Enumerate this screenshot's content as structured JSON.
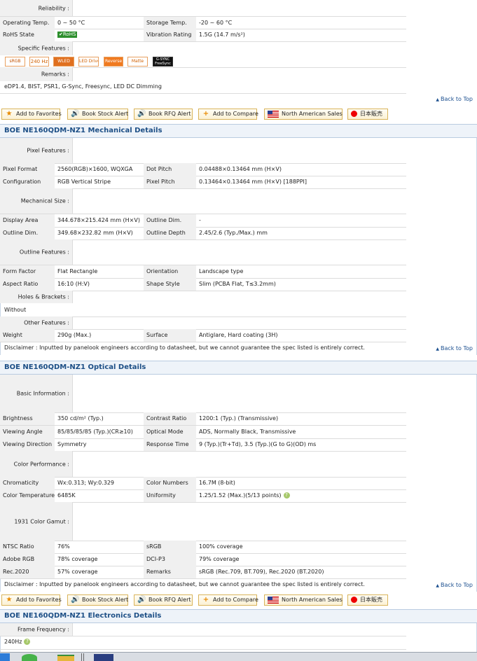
{
  "reliability": {
    "header": "Reliability :",
    "rows": [
      {
        "l1": "Operating Temp.",
        "v1": "0 ~ 50 °C",
        "l2": "Storage Temp.",
        "v2": "-20 ~ 60 °C"
      },
      {
        "l1": "RoHS State",
        "v1": "RoHS",
        "l2": "Vibration Rating",
        "v2": "1.5G (14.7 m/s²)"
      }
    ],
    "specific_features_label": "Specific Features :",
    "features": [
      "sRGB",
      "240 Hz",
      "WLED",
      "LED Driver",
      "Reverse",
      "Matte",
      "G-SYNC FreeSync"
    ],
    "remarks_label": "Remarks :",
    "remarks": "eDP1.4, BIST, PSR1, G-Sync, Freesync, LED DC Dimming",
    "back_to_top": "Back to Top"
  },
  "actions": {
    "favorites": "Add to Favorites",
    "stock_alert": "Book Stock Alert",
    "rfq_alert": "Book RFQ Alert",
    "compare": "Add to Compare",
    "na_sales": "North American Sales",
    "jp": "日本販売"
  },
  "mechanical": {
    "title": "BOE NE160QDM-NZ1 Mechanical Details",
    "pixel_features": "Pixel Features :",
    "rows_pixel": [
      {
        "l1": "Pixel Format",
        "v1": "2560(RGB)×1600, WQXGA",
        "l2": "Dot Pitch",
        "v2": "0.04488×0.13464 mm (H×V)"
      },
      {
        "l1": "Configuration",
        "v1": "RGB Vertical Stripe",
        "l2": "Pixel Pitch",
        "v2": "0.13464×0.13464 mm (H×V)  [188PPI]"
      }
    ],
    "mechanical_size": "Mechanical Size :",
    "rows_size": [
      {
        "l1": "Display Area",
        "v1": "344.678×215.424 mm (H×V)",
        "l2": "Outline Dim.",
        "v2": "-"
      },
      {
        "l1": "Outline Dim.",
        "v1": "349.68×232.82 mm (H×V)",
        "l2": "Outline Depth",
        "v2": "2.45/2.6 (Typ./Max.) mm"
      }
    ],
    "outline_features": "Outline Features :",
    "rows_outline": [
      {
        "l1": "Form Factor",
        "v1": "Flat Rectangle",
        "l2": "Orientation",
        "v2": "Landscape type"
      },
      {
        "l1": "Aspect Ratio",
        "v1": "16:10 (H:V)",
        "l2": "Shape Style",
        "v2": "Slim (PCBA Flat, T≤3.2mm)"
      }
    ],
    "holes_brackets": "Holes & Brackets :",
    "holes_value": "Without",
    "other_features": "Other Features :",
    "rows_other": [
      {
        "l1": "Weight",
        "v1": "290g (Max.)",
        "l2": "Surface",
        "v2": "Antiglare, Hard coating (3H)"
      }
    ],
    "disclaimer": "Disclaimer : Inputted by panelook engineers according to datasheet, but we cannot guarantee the spec listed is entirely correct.",
    "back_to_top": "Back to Top"
  },
  "optical": {
    "title": "BOE NE160QDM-NZ1 Optical Details",
    "basic_info": "Basic Information :",
    "rows_basic": [
      {
        "l1": "Brightness",
        "v1": "350 cd/m² (Typ.)",
        "l2": "Contrast Ratio",
        "v2": "1200:1 (Typ.) (Transmissive)"
      },
      {
        "l1": "Viewing Angle",
        "v1": "85/85/85/85 (Typ.)(CR≥10)",
        "l2": "Optical Mode",
        "v2": "ADS, Normally Black, Transmissive"
      },
      {
        "l1": "Viewing Direction",
        "v1": "Symmetry",
        "l2": "Response Time",
        "v2": "9 (Typ.)(Tr+Td), 3.5 (Typ.)(G to G)(OD) ms"
      }
    ],
    "color_performance": "Color Performance :",
    "rows_color": [
      {
        "l1": "Chromaticity",
        "v1": "Wx:0.313; Wy:0.329",
        "l2": "Color Numbers",
        "v2": "16.7M (8-bit)"
      },
      {
        "l1": "Color Temperature",
        "v1": "6485K",
        "l2": "Uniformity",
        "v2": "1.25/1.52 (Max.)(5/13 points)"
      }
    ],
    "gamut": "1931 Color Gamut :",
    "rows_gamut": [
      {
        "l1": "NTSC Ratio",
        "v1": "76%",
        "l2": "sRGB",
        "v2": "100% coverage"
      },
      {
        "l1": "Adobe RGB",
        "v1": "78% coverage",
        "l2": "DCI-P3",
        "v2": "79% coverage"
      },
      {
        "l1": "Rec.2020",
        "v1": "57% coverage",
        "l2": "Remarks",
        "v2": "sRGB (Rec.709, BT.709), Rec.2020 (BT.2020)"
      }
    ],
    "disclaimer": "Disclaimer : Inputted by panelook engineers according to datasheet, but we cannot guarantee the spec listed is entirely correct.",
    "back_to_top": "Back to Top"
  },
  "electronics": {
    "title": "BOE NE160QDM-NZ1 Electronics Details",
    "frame_frequency": "Frame Frequency :",
    "frame_value": "240Hz"
  },
  "help_icon": "?"
}
